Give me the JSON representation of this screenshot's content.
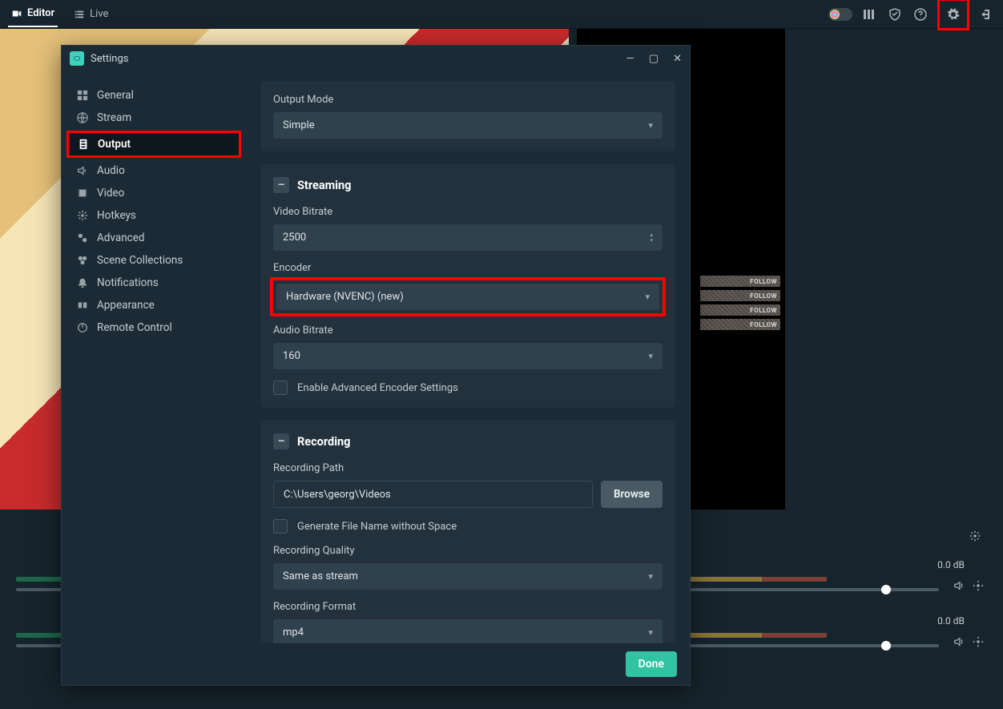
{
  "topbar": {
    "tabs": {
      "editor": "Editor",
      "live": "Live"
    }
  },
  "followers": [
    "FOLLOW",
    "FOLLOW",
    "FOLLOW",
    "FOLLOW"
  ],
  "mixer": {
    "db1": "0.0 dB",
    "db2": "0.0 dB"
  },
  "dialog": {
    "title": "Settings",
    "sidebar": {
      "general": "General",
      "stream": "Stream",
      "output": "Output",
      "audio": "Audio",
      "video": "Video",
      "hotkeys": "Hotkeys",
      "advanced": "Advanced",
      "scene_collections": "Scene Collections",
      "notifications": "Notifications",
      "appearance": "Appearance",
      "remote_control": "Remote Control"
    },
    "output_mode_label": "Output Mode",
    "output_mode_value": "Simple",
    "streaming": {
      "title": "Streaming",
      "video_bitrate_label": "Video Bitrate",
      "video_bitrate_value": "2500",
      "encoder_label": "Encoder",
      "encoder_value": "Hardware (NVENC) (new)",
      "audio_bitrate_label": "Audio Bitrate",
      "audio_bitrate_value": "160",
      "enable_advanced": "Enable Advanced Encoder Settings"
    },
    "recording": {
      "title": "Recording",
      "path_label": "Recording Path",
      "path_value": "C:\\Users\\georg\\Videos",
      "browse": "Browse",
      "generate_filename": "Generate File Name without Space",
      "quality_label": "Recording Quality",
      "quality_value": "Same as stream",
      "format_label": "Recording Format",
      "format_value": "mp4"
    },
    "done": "Done"
  }
}
